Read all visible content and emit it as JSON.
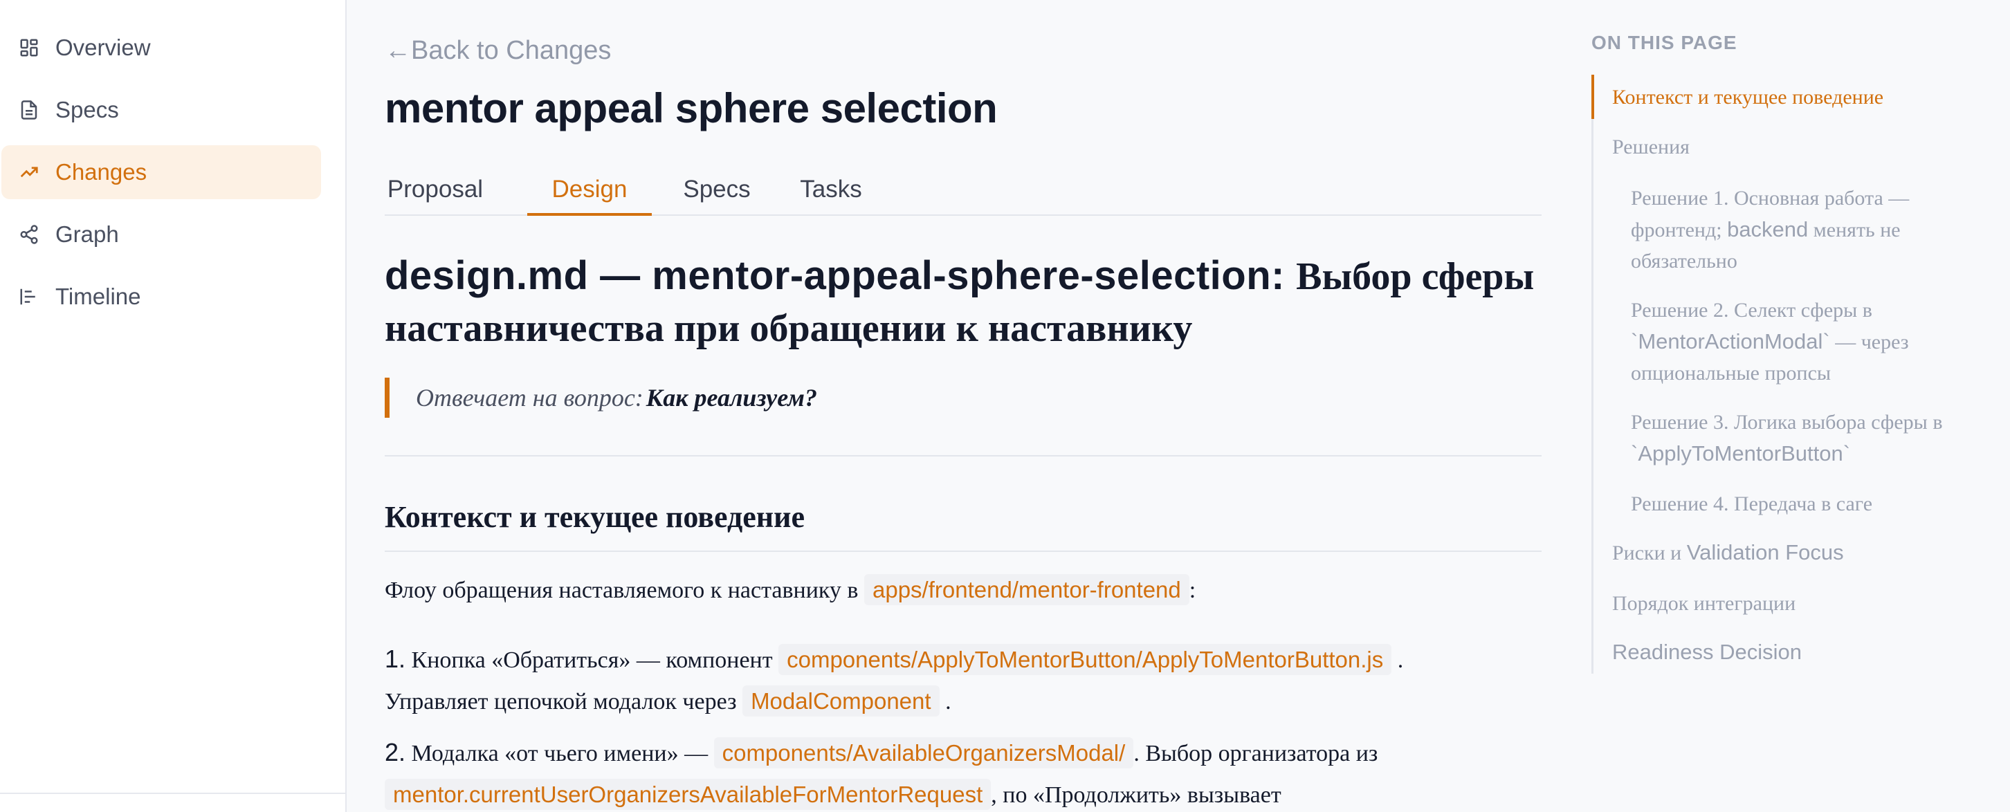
{
  "sidebar": {
    "items": [
      {
        "label": "Overview",
        "icon": "grid-icon",
        "active": false
      },
      {
        "label": "Specs",
        "icon": "document-icon",
        "active": false
      },
      {
        "label": "Changes",
        "icon": "trending-up-icon",
        "active": true
      },
      {
        "label": "Graph",
        "icon": "share-nodes-icon",
        "active": false
      },
      {
        "label": "Timeline",
        "icon": "timeline-bars-icon",
        "active": false
      }
    ]
  },
  "main": {
    "back_arrow": "←",
    "back_label": "Back to Changes",
    "title": "mentor appeal sphere selection",
    "tabs": [
      {
        "label": "Proposal",
        "active": false
      },
      {
        "label": "Design",
        "active": true
      },
      {
        "label": "Specs",
        "active": false
      },
      {
        "label": "Tasks",
        "active": false
      }
    ],
    "doc_heading_prefix": "design.md — mentor-appeal-sphere-selection:",
    "doc_heading_ru_1": "Выбор сферы",
    "doc_heading_ru_2": "наставничества при обращении к наставнику",
    "quote_text": "Отвечает на вопрос:",
    "quote_bold": "Как реализуем?",
    "section_heading": "Контекст и текущее поведение",
    "intro_text": "Флоу обращения наставляемого к наставнику в",
    "intro_code": "apps/frontend/mentor-frontend",
    "intro_suffix": ":",
    "item1_num": "1.",
    "item1_text": "Кнопка «Обратиться» — компонент",
    "item1_code": "components/ApplyToMentorButton/ApplyToMentorButton.js",
    "item1_suffix": ".",
    "item1_line2_text": "Управляет цепочкой модалок через",
    "item1_line2_code": "ModalComponent",
    "item1_line2_suffix": ".",
    "item2_num": "2.",
    "item2_text": "Модалка «от чьего имени» —",
    "item2_code": "components/AvailableOrganizersModal/",
    "item2_suffix": ". Выбор организатора из",
    "item2_line2_code": "mentor.currentUserOrganizersAvailableForMentorRequest",
    "item2_line2_suffix": ", по «Продолжить» вызывает"
  },
  "toc": {
    "heading": "ON THIS PAGE",
    "items": [
      {
        "label": "Контекст и текущее поведение"
      },
      {
        "label": "Решения"
      },
      {
        "label_a": "Решение 1. Основная работа —",
        "label_b": "фронтенд; ",
        "label_b_sans": "backend",
        "label_b_tail": " менять не",
        "label_c": "обязательно"
      },
      {
        "label_a": "Решение 2. Селект сферы в",
        "label_b_sans": "`MentorActionModal`",
        "label_b_tail": " — через",
        "label_c": "опциональные пропсы"
      },
      {
        "label_a": "Решение 3. Логика выбора сферы в",
        "label_b_sans": "`ApplyToMentorButton`"
      },
      {
        "label": "Решение 4. Передача в саге"
      },
      {
        "label": "Риски и ",
        "label_sans": "Validation Focus"
      },
      {
        "label": "Порядок интеграции"
      },
      {
        "label_sans": "Readiness Decision"
      }
    ]
  },
  "colors": {
    "accent": "#d2700e",
    "accent_bg": "#fdf1e4",
    "text": "#141a2b",
    "muted": "#9aa1b0"
  }
}
